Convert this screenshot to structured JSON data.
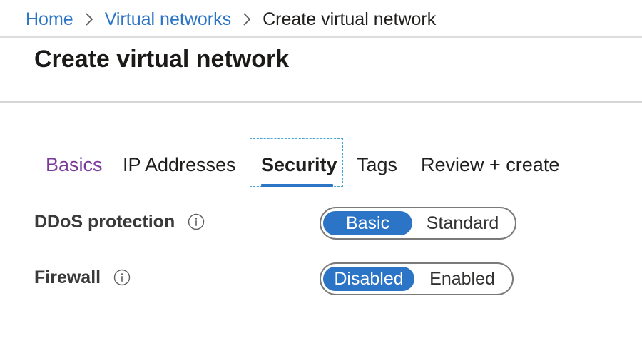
{
  "breadcrumb": {
    "items": [
      "Home",
      "Virtual networks"
    ],
    "current": "Create virtual network"
  },
  "page": {
    "title": "Create virtual network"
  },
  "tabs": [
    {
      "label": "Basics",
      "state": "visited"
    },
    {
      "label": "IP Addresses",
      "state": "default"
    },
    {
      "label": "Security",
      "state": "active"
    },
    {
      "label": "Tags",
      "state": "default"
    },
    {
      "label": "Review + create",
      "state": "default"
    }
  ],
  "fields": {
    "ddos": {
      "label": "DDoS protection",
      "options": [
        "Basic",
        "Standard"
      ],
      "selected": "Basic"
    },
    "firewall": {
      "label": "Firewall",
      "options": [
        "Disabled",
        "Enabled"
      ],
      "selected": "Disabled"
    }
  },
  "icons": {
    "breadcrumb_separator": "chevron-right-icon",
    "info": "info-icon"
  },
  "colors": {
    "accent": "#2b74c6",
    "visited_tab": "#7a3a9a",
    "focus_outline": "#44a5d8"
  }
}
